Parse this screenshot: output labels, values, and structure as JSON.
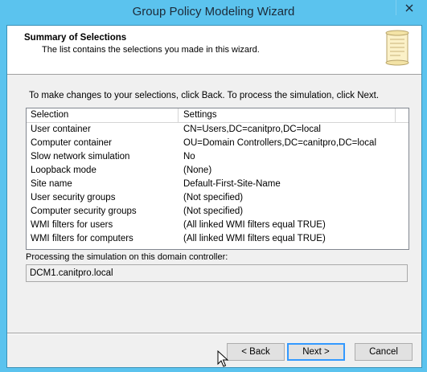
{
  "window": {
    "title": "Group Policy Modeling Wizard",
    "close_glyph": "✕"
  },
  "header": {
    "title": "Summary of Selections",
    "subtitle": "The list contains the selections you made in this wizard.",
    "icon": "scroll-icon"
  },
  "instruction": "To make changes to your selections, click Back.  To process the simulation, click Next.",
  "table": {
    "columns": [
      "Selection",
      "Settings"
    ],
    "rows": [
      {
        "selection": "User container",
        "settings": "CN=Users,DC=canitpro,DC=local"
      },
      {
        "selection": "Computer container",
        "settings": "OU=Domain Controllers,DC=canitpro,DC=local"
      },
      {
        "selection": "Slow network simulation",
        "settings": "No"
      },
      {
        "selection": "Loopback mode",
        "settings": "(None)"
      },
      {
        "selection": "Site name",
        "settings": "Default-First-Site-Name"
      },
      {
        "selection": "User security groups",
        "settings": "(Not specified)"
      },
      {
        "selection": "Computer security groups",
        "settings": "(Not specified)"
      },
      {
        "selection": "WMI filters for users",
        "settings": "(All linked WMI filters equal TRUE)"
      },
      {
        "selection": "WMI filters for computers",
        "settings": "(All linked WMI filters equal TRUE)"
      }
    ]
  },
  "processing": {
    "label": "Processing the simulation on this domain controller:",
    "value": "DCM1.canitpro.local"
  },
  "buttons": {
    "back": "< Back",
    "next": "Next >",
    "cancel": "Cancel"
  },
  "colors": {
    "titlebar": "#5bc3ee",
    "dialog": "#f0f0f0",
    "default_button_border": "#3399ff"
  }
}
